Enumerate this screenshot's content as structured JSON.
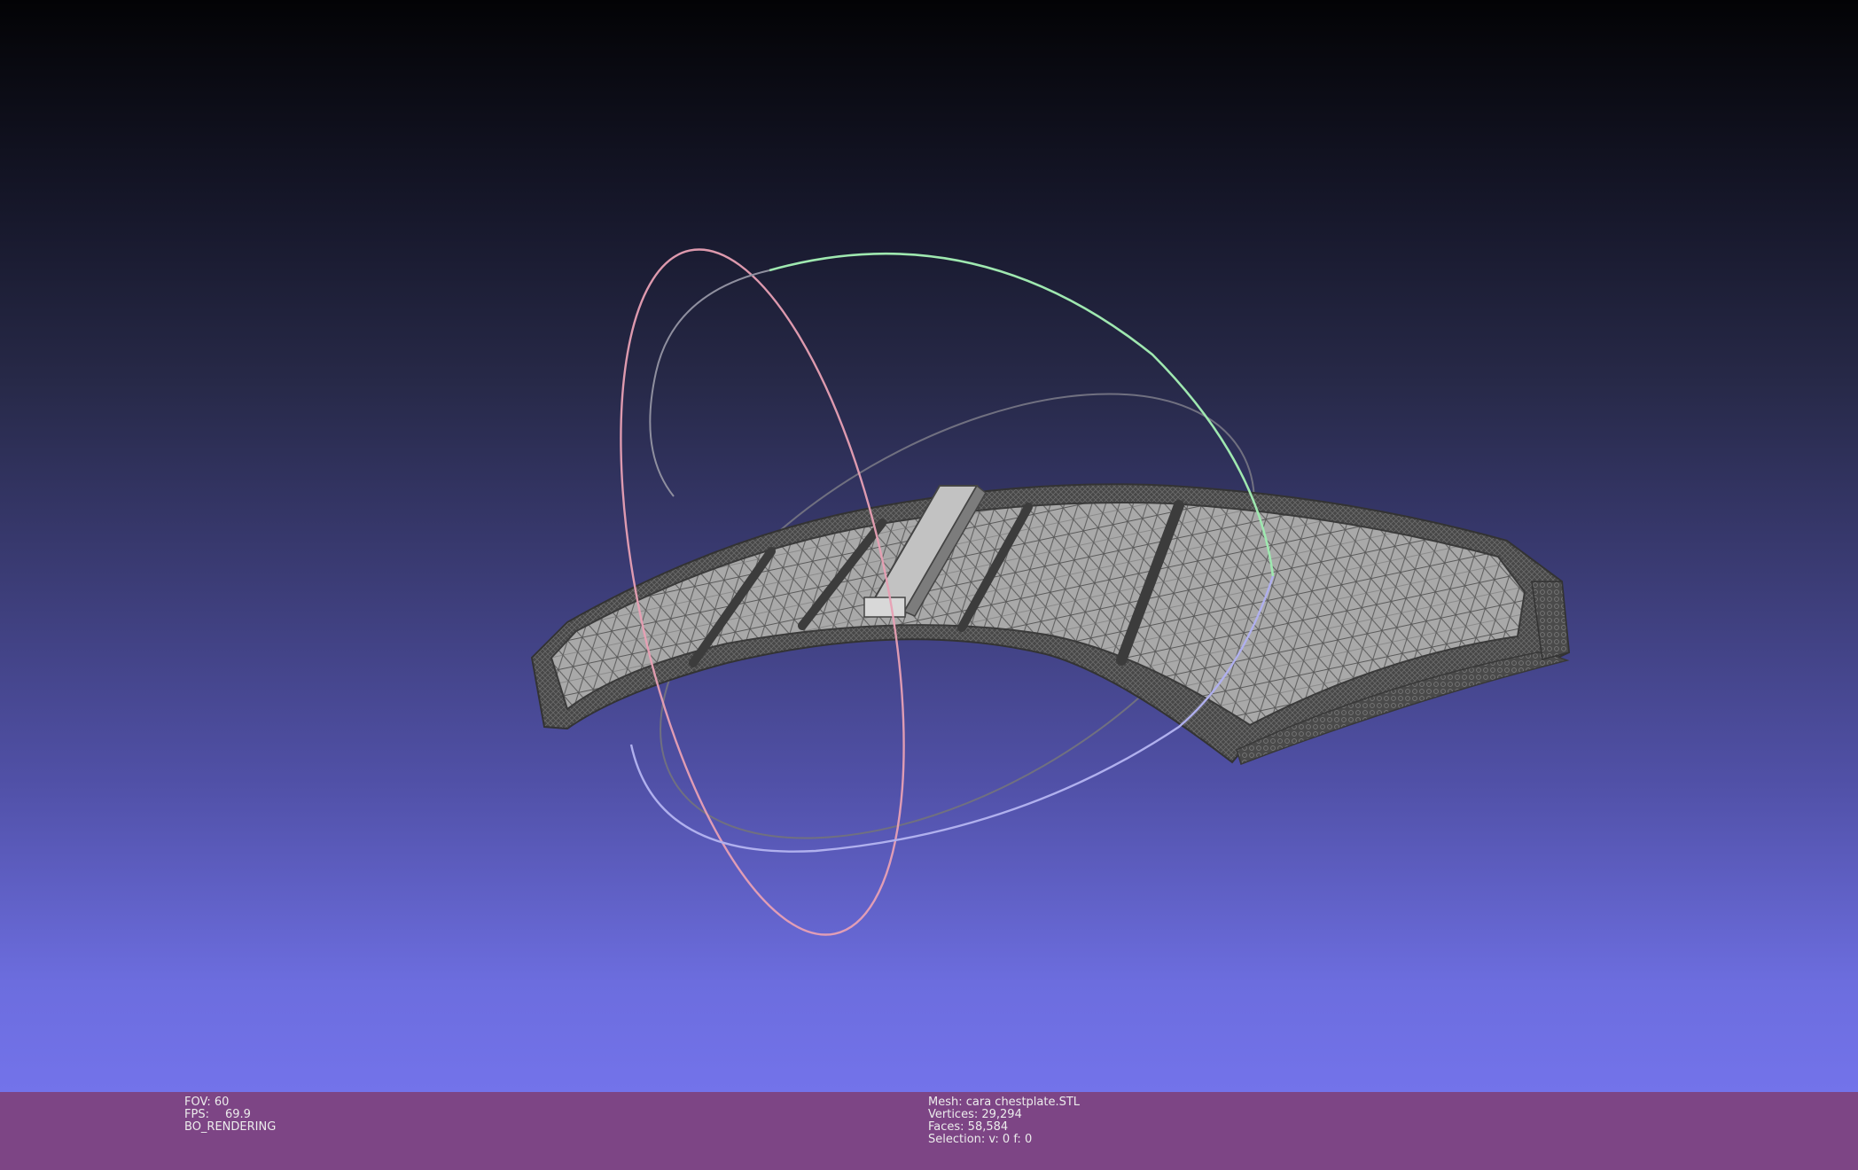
{
  "viewer": {
    "mode": "BO_RENDERING",
    "colors": {
      "background_top": "#030305",
      "background_bottom": "#7373ea",
      "infobar": "#7d4585",
      "mesh_fill": "#a8a8a8",
      "mesh_edge": "#3f3f3f",
      "trackball_x": "#f0a0b8",
      "trackball_y": "#a0f0b0",
      "trackball_z": "#b0b0f0"
    }
  },
  "info_left": {
    "fov_label": "FOV: 60",
    "fps_label": "FPS:",
    "fps_value": "69.9",
    "render_mode": "BO_RENDERING"
  },
  "info_center": {
    "mesh": "Mesh: cara chestplate.STL",
    "vertices": "Vertices: 29,294",
    "faces": "Faces: 58,584",
    "selection": "Selection: v: 0 f: 0"
  }
}
